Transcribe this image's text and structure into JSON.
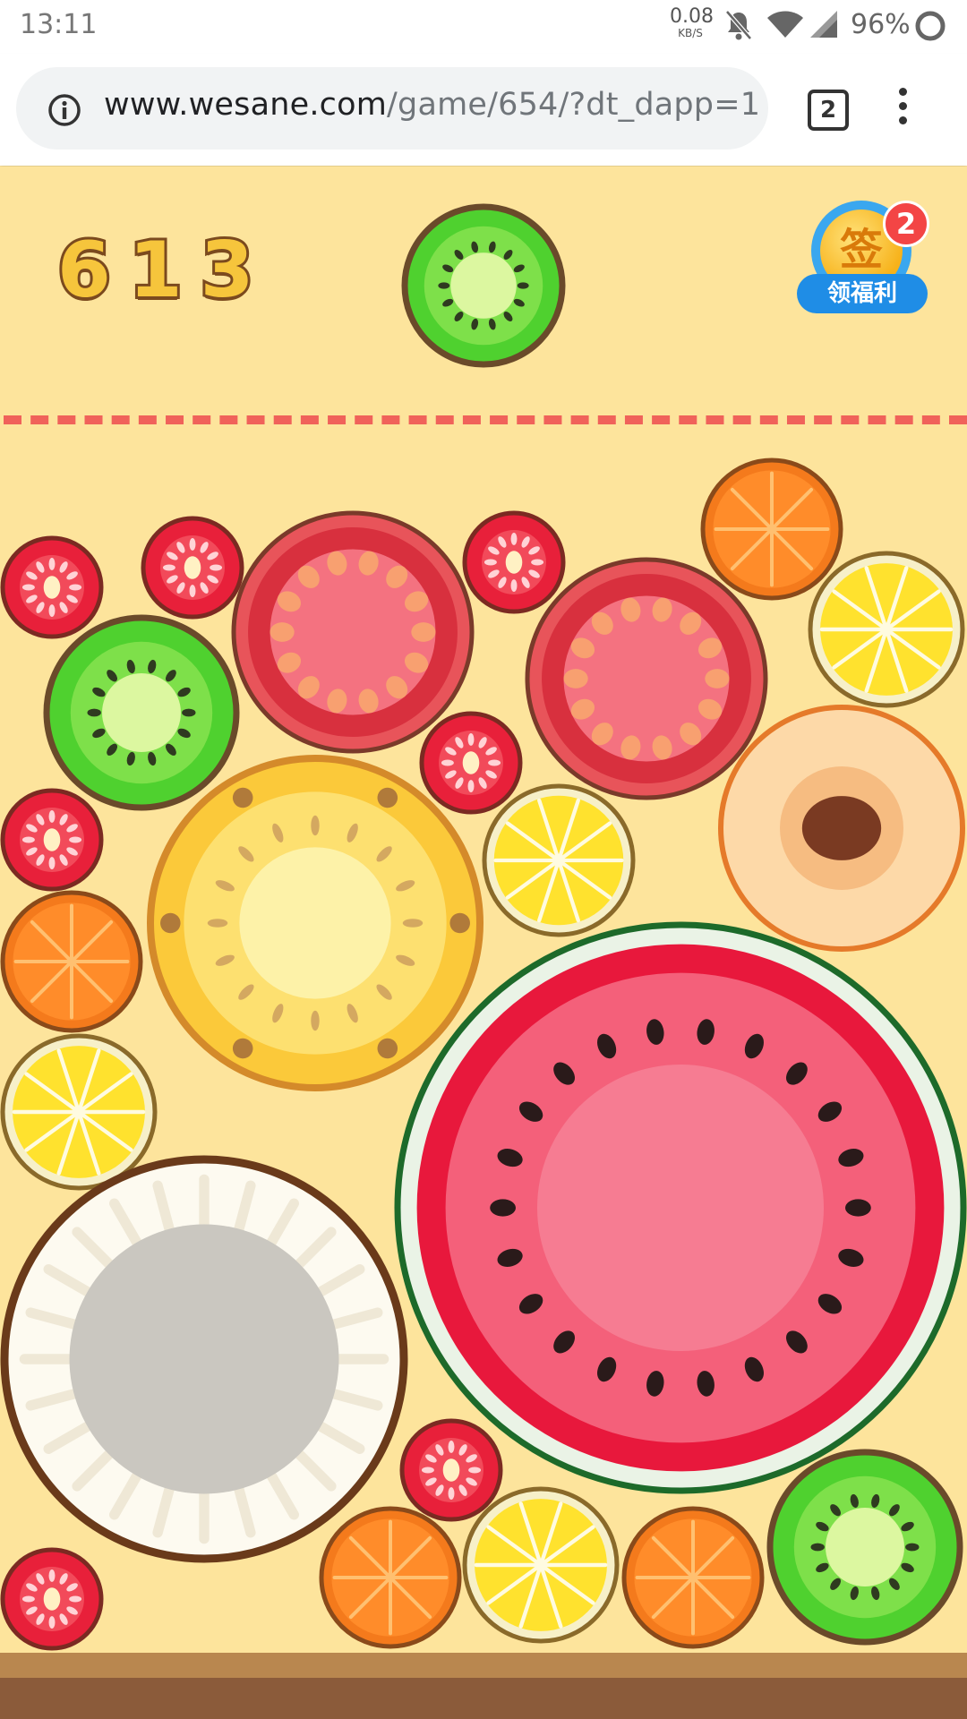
{
  "status_bar": {
    "time": "13:11",
    "net_speed": "0.08",
    "net_unit": "KB/S",
    "battery": "96%",
    "icons": [
      "bell-off-icon",
      "wifi-icon",
      "signal-icon",
      "battery-ring-icon"
    ]
  },
  "browser": {
    "url_host": "www.wesane.com",
    "url_path": "/game/654/?dt_dapp=1",
    "tab_count": "2",
    "icons": [
      "info-icon",
      "tabs-icon",
      "more-vert-icon"
    ]
  },
  "game": {
    "score": "613",
    "next_fruit": "kiwi",
    "signin": {
      "badge": "2",
      "coin_char": "签",
      "label": "领福利"
    },
    "fruits_on_board": [
      "raspberry",
      "raspberry",
      "tomato",
      "raspberry",
      "tomato",
      "orange",
      "lemon",
      "kiwi",
      "raspberry",
      "pineapple",
      "lemon",
      "peach",
      "raspberry",
      "orange",
      "lemon",
      "watermelon",
      "coconut",
      "raspberry",
      "orange",
      "lemon",
      "orange",
      "kiwi",
      "raspberry"
    ],
    "colors": {
      "background": "#fde49c",
      "deadline": "#f0625a",
      "ground": "#8b5b3a",
      "score_fill": "#f6c53c",
      "score_outline": "#7b4a1e"
    }
  }
}
